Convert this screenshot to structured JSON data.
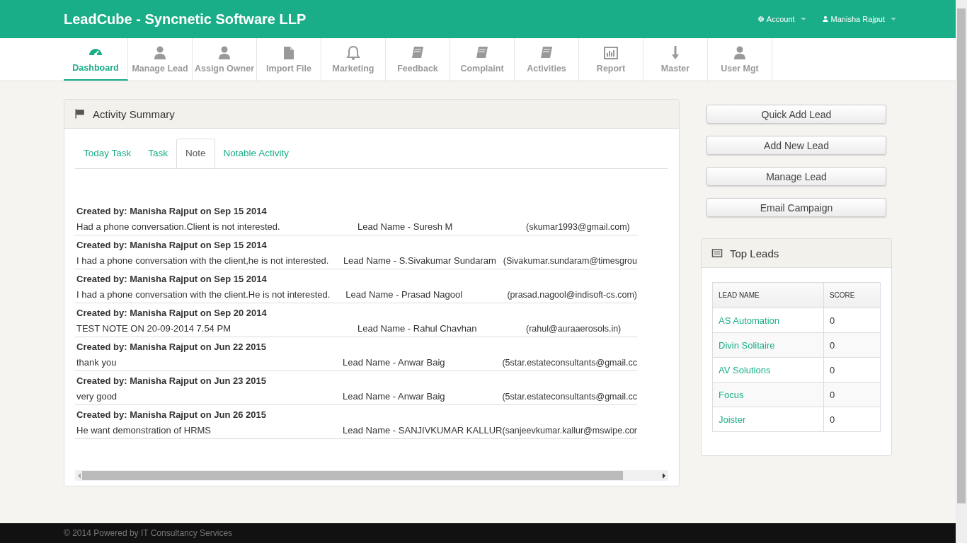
{
  "header": {
    "brand": "LeadCube - Syncnetic Software LLP",
    "menus": [
      {
        "kind": "gear",
        "label": "Account"
      },
      {
        "kind": "user",
        "label": "Manisha Rajput"
      }
    ]
  },
  "nav": [
    {
      "kind": "dashboard",
      "label": "Dashboard",
      "selected": true
    },
    {
      "kind": "user",
      "label": "Manage Lead",
      "selected": false
    },
    {
      "kind": "user",
      "label": "Assign Owner",
      "selected": false
    },
    {
      "kind": "file",
      "label": "Import File",
      "selected": false
    },
    {
      "kind": "bell",
      "label": "Marketing",
      "selected": false
    },
    {
      "kind": "book",
      "label": "Feedback",
      "selected": false
    },
    {
      "kind": "book",
      "label": "Complaint",
      "selected": false
    },
    {
      "kind": "book",
      "label": "Activities",
      "selected": false
    },
    {
      "kind": "chart",
      "label": "Report",
      "selected": false
    },
    {
      "kind": "arrow",
      "label": "Master",
      "selected": false
    },
    {
      "kind": "user",
      "label": "User Mgt",
      "selected": false
    }
  ],
  "activity_summary": {
    "title": "Activity Summary",
    "tabs": [
      {
        "label": "Today Task",
        "selected": false
      },
      {
        "label": "Task",
        "selected": false
      },
      {
        "label": "Note",
        "selected": true
      },
      {
        "label": "Notable Activity",
        "selected": false
      }
    ],
    "notes": [
      {
        "created": "Created by: Manisha Rajput on Sep 15 2014",
        "text": "Had a phone conversation.Client is not interested.",
        "lead": "Lead Name - Suresh M",
        "email": "(skumar1993@gmail.com)"
      },
      {
        "created": "Created by: Manisha Rajput on Sep 15 2014",
        "text": "I had a phone conversation with the client,he is not interested.",
        "lead": "Lead Name - S.Sivakumar Sundaram",
        "email": "(Sivakumar.sundaram@timesgrou"
      },
      {
        "created": "Created by: Manisha Rajput on Sep 15 2014",
        "text": "I had a phone conversation with the client.He is not interested.",
        "lead": "Lead Name - Prasad Nagool",
        "email": "(prasad.nagool@indisoft-cs.com)"
      },
      {
        "created": "Created by: Manisha Rajput on Sep 20 2014",
        "text": "TEST NOTE ON 20-09-2014 7.54 PM",
        "lead": "Lead Name - Rahul Chavhan",
        "email": "(rahul@auraaerosols.in)"
      },
      {
        "created": "Created by: Manisha Rajput on Jun 22 2015",
        "text": "thank you",
        "lead": "Lead Name - Anwar Baig",
        "email": "(5star.estateconsultants@gmail.cc"
      },
      {
        "created": "Created by: Manisha Rajput on Jun 23 2015",
        "text": "very good",
        "lead": "Lead Name - Anwar Baig",
        "email": "(5star.estateconsultants@gmail.cc"
      },
      {
        "created": "Created by: Manisha Rajput on Jun 26 2015",
        "text": "He want demonstration of HRMS",
        "lead": "Lead Name - SANJIVKUMAR KALLUR",
        "email": "(sanjeevkumar.kallur@mswipe.cor"
      }
    ]
  },
  "actions": [
    "Quick Add Lead",
    "Add New Lead",
    "Manage Lead",
    "Email Campaign"
  ],
  "top_leads": {
    "title": "Top Leads",
    "columns": [
      "LEAD NAME",
      "SCORE"
    ],
    "rows": [
      [
        "AS Automation",
        "0"
      ],
      [
        "Divin Solitaire",
        "0"
      ],
      [
        "AV Solutions",
        "0"
      ],
      [
        "Focus",
        "0"
      ],
      [
        "Joister",
        "0"
      ]
    ]
  },
  "footer": "© 2014 Powered by IT Consultancy Services"
}
